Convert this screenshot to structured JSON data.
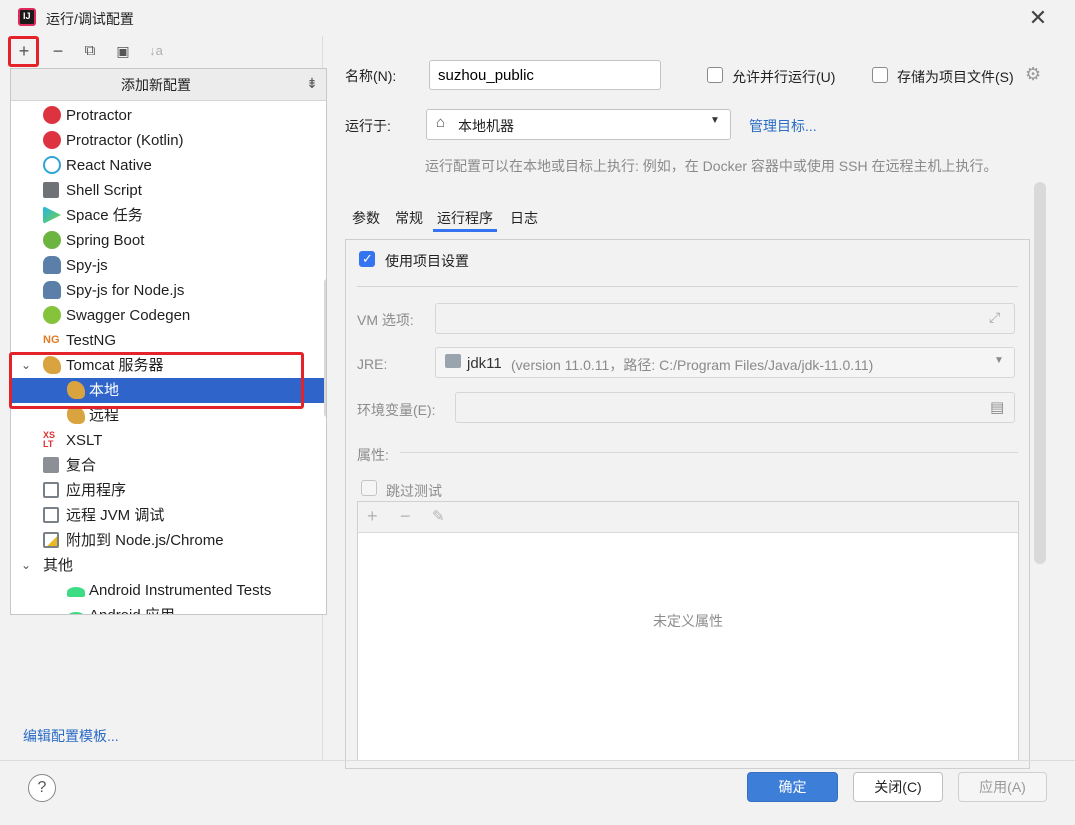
{
  "window": {
    "title": "运行/调试配置",
    "close_glyph": "✕"
  },
  "toolbar": {
    "add": "+",
    "remove": "−",
    "copy": "⧉",
    "folder": "▣",
    "sort": "↓a"
  },
  "popup": {
    "title": "添加新配置",
    "items": [
      {
        "label": "Protractor",
        "icon": "protractor-icon"
      },
      {
        "label": "Protractor (Kotlin)",
        "icon": "protractor-icon"
      },
      {
        "label": "React Native",
        "icon": "react-icon"
      },
      {
        "label": "Shell Script",
        "icon": "shell-icon"
      },
      {
        "label": "Space 任务",
        "icon": "space-icon"
      },
      {
        "label": "Spring Boot",
        "icon": "spring-icon"
      },
      {
        "label": "Spy-js",
        "icon": "spy-icon"
      },
      {
        "label": "Spy-js for Node.js",
        "icon": "spy-icon"
      },
      {
        "label": "Swagger Codegen",
        "icon": "swagger-icon"
      },
      {
        "label": "TestNG",
        "icon": "testng-icon"
      },
      {
        "label": "Tomcat 服务器",
        "icon": "tomcat-icon"
      },
      {
        "label": "本地",
        "icon": "tomcat-icon"
      },
      {
        "label": "远程",
        "icon": "tomcat-icon"
      },
      {
        "label": "XSLT",
        "icon": "xslt-icon"
      },
      {
        "label": "复合",
        "icon": "compound-icon"
      },
      {
        "label": "应用程序",
        "icon": "application-icon"
      },
      {
        "label": "远程 JVM 调试",
        "icon": "remote-jvm-icon"
      },
      {
        "label": "附加到 Node.js/Chrome",
        "icon": "attach-node-icon"
      },
      {
        "label": "其他",
        "icon": "chevron-down-icon"
      },
      {
        "label": "Android Instrumented Tests",
        "icon": "android-icon"
      },
      {
        "label": "Android 应用",
        "icon": "android-icon"
      }
    ]
  },
  "edit_templates": "编辑配置模板...",
  "form": {
    "name_label": "名称(N):",
    "name_value": "suzhou_public",
    "allow_parallel": "允许并行运行(U)",
    "store_as_file": "存储为项目文件(S)",
    "run_on_label": "运行于:",
    "run_on_value": "本地机器",
    "manage_targets": "管理目标...",
    "hint": "运行配置可以在本地或目标上执行: 例如，在 Docker 容器中或使用 SSH 在远程主机上执行。",
    "tabs": [
      "参数",
      "常规",
      "运行程序",
      "日志"
    ],
    "use_project_settings": "使用项目设置",
    "vm_label": "VM 选项:",
    "jre_label": "JRE:",
    "jre_name": "jdk11",
    "jre_detail": "(version 11.0.11，路径: C:/Program Files/Java/jdk-11.0.11)",
    "env_label": "环境变量(E):",
    "props_label": "属性:",
    "skip_tests": "跳过测试",
    "empty_props": "未定义属性"
  },
  "buttons": {
    "ok": "确定",
    "close": "关闭(C)",
    "apply": "应用(A)",
    "help": "?"
  },
  "colors": {
    "accent": "#3574f0",
    "selection": "#2f65ca",
    "highlight": "#e3222a"
  }
}
